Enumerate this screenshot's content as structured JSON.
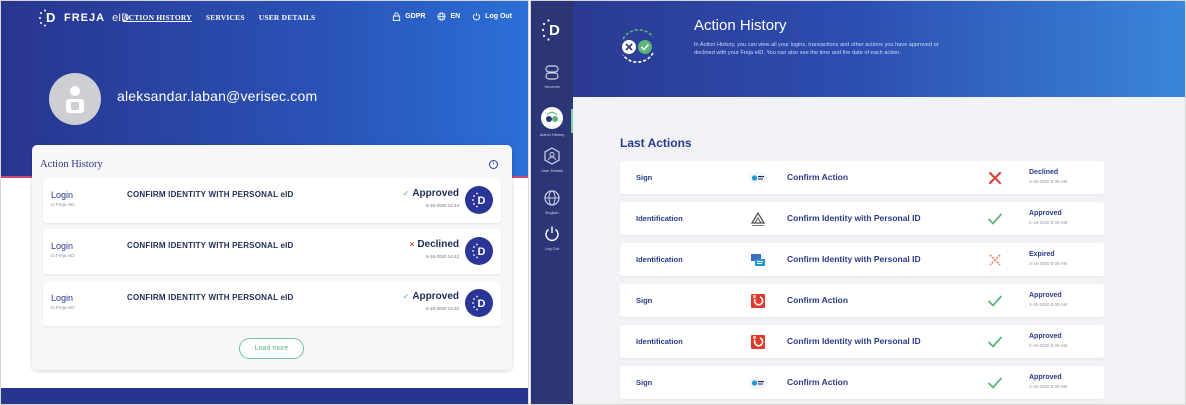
{
  "left": {
    "logo": {
      "brand": "FREJA",
      "suffix": "eID"
    },
    "nav": {
      "links": [
        "ACTION HISTORY",
        "SERVICES",
        "USER DETAILS"
      ],
      "gdpr": "GDPR",
      "lang": "EN",
      "logout": "Log Out"
    },
    "profile": {
      "email": "aleksandar.laban@verisec.com"
    },
    "card": {
      "title": "Action History",
      "info": "i",
      "rows": [
        {
          "action": "Login",
          "sub": "to Freja eID",
          "desc": "CONFIRM IDENTITY WITH PERSONAL eID",
          "status": "Approved",
          "status_mark": "✓",
          "time": "6-16-2020 14:43"
        },
        {
          "action": "Login",
          "sub": "to Freja eID",
          "desc": "CONFIRM IDENTITY WITH PERSONAL eID",
          "status": "Declined",
          "status_mark": "×",
          "time": "6-16-2020 14:42"
        },
        {
          "action": "Login",
          "sub": "to Freja eID",
          "desc": "CONFIRM IDENTITY WITH PERSONAL eID",
          "status": "Approved",
          "status_mark": "✓",
          "time": "6-16-2020 14:32"
        }
      ],
      "load_more": "Load more"
    }
  },
  "right": {
    "sidebar": {
      "items": [
        {
          "label": "Services",
          "icon": "services-icon"
        },
        {
          "label": "Action History",
          "icon": "action-history-icon"
        },
        {
          "label": "User Details",
          "icon": "user-details-icon"
        },
        {
          "label": "English",
          "icon": "globe-icon"
        },
        {
          "label": "Log Out",
          "icon": "power-icon"
        }
      ]
    },
    "hero": {
      "title": "Action History",
      "text": "In Action History, you can view all your logins, transactions and other actions you have approved or declined with your Freja eID. You can also see the time and the date of each action."
    },
    "last_title": "Last Actions",
    "rows": [
      {
        "type": "Sign",
        "title": "Confirm Action",
        "status": "Declined",
        "date": "3-16-2020 8:00 AM",
        "provider": "provider-blue-dot-logo",
        "status_icon": "declined-x-icon"
      },
      {
        "type": "Identification",
        "title": "Confirm Identity with Personal ID",
        "status": "Approved",
        "date": "3-16-2020 8:00 AM",
        "provider": "provider-grey-logo",
        "status_icon": "approved-check-icon"
      },
      {
        "type": "Identification",
        "title": "Confirm Identity with Personal ID",
        "status": "Expired",
        "date": "3-16-2020 8:00 AM",
        "provider": "provider-blue-doc-logo",
        "status_icon": "expired-x-icon"
      },
      {
        "type": "Sign",
        "title": "Confirm Action",
        "status": "Approved",
        "date": "3-16-2020 8:00 AM",
        "provider": "provider-red-logo",
        "status_icon": "approved-check-icon"
      },
      {
        "type": "Identification",
        "title": "Confirm Identity with Personal ID",
        "status": "Approved",
        "date": "3-16-2020 8:00 AM",
        "provider": "provider-red-logo",
        "status_icon": "approved-check-icon"
      },
      {
        "type": "Sign",
        "title": "Confirm Action",
        "status": "Approved",
        "date": "3-16-2020 8:00 AM",
        "provider": "provider-blue-dot-logo",
        "status_icon": "approved-check-icon"
      }
    ]
  },
  "colors": {
    "brand_navy": "#2a3a88",
    "hero_blue": "#2c4db0",
    "approved_green": "#5ab57a",
    "declined_red": "#d9423c",
    "expired_orange": "#e88a6a",
    "accent_pink": "#d04779"
  }
}
